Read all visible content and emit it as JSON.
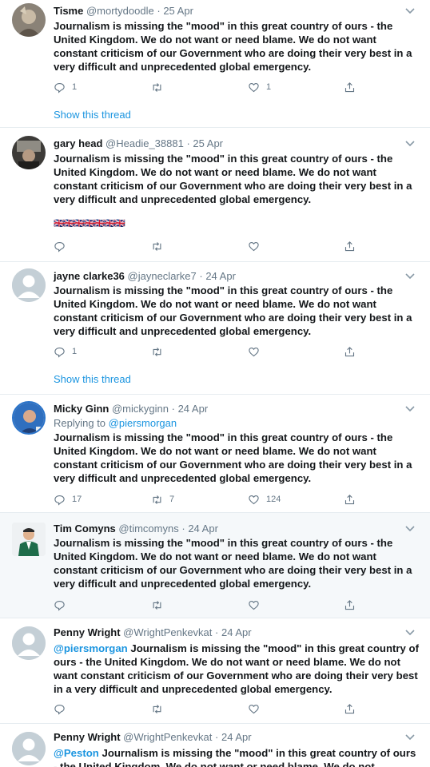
{
  "tweets": [
    {
      "name": "Tisme",
      "handle": "@mortydoodle",
      "date": "25 Apr",
      "text": "Journalism is missing the \"mood\" in this great country of ours - the United Kingdom. We do not want or need blame. We do not want constant criticism of our Government who are doing their very best in a very difficult and unprecedented global emergency.",
      "reply_count": "1",
      "retweet_count": "",
      "like_count": "1",
      "show_thread": "Show this thread"
    },
    {
      "name": "gary head",
      "handle": "@Headie_38881",
      "date": "25 Apr",
      "text": "Journalism is missing the \"mood\" in this great country of ours - the United Kingdom. We do not want or need blame. We do not want constant criticism of our Government who are doing their very best in a very difficult and unprecedented global emergency.",
      "flags": "🇬🇧🇬🇧🇬🇧🇬🇧🇬🇧🇬🇧🇬🇧",
      "reply_count": "",
      "retweet_count": "",
      "like_count": ""
    },
    {
      "name": "jayne clarke36",
      "handle": "@jayneclarke7",
      "date": "24 Apr",
      "text": "Journalism is missing the \"mood\" in this great country of ours - the United Kingdom. We do not want or need blame. We do not want constant criticism of our Government who are doing their very best in a very difficult and unprecedented global emergency.",
      "reply_count": "1",
      "retweet_count": "",
      "like_count": "",
      "show_thread": "Show this thread"
    },
    {
      "name": "Micky Ginn",
      "handle": "@mickyginn",
      "date": "24 Apr",
      "replying_prefix": "Replying to",
      "replying_handle": "@piersmorgan",
      "text": "Journalism is missing the \"mood\" in this great country of ours - the United Kingdom. We do not want or need blame. We do not want constant criticism of our Government who are doing their very best in a very difficult and unprecedented global emergency.",
      "reply_count": "17",
      "retweet_count": "7",
      "like_count": "124"
    },
    {
      "name": "Tim Comyns",
      "handle": "@timcomyns",
      "date": "24 Apr",
      "text": "Journalism is missing the \"mood\" in this great country of ours - the United Kingdom. We do not want or need blame. We do not want constant criticism of our Government who are doing their very best in a very difficult and unprecedented global emergency.",
      "reply_count": "",
      "retweet_count": "",
      "like_count": ""
    },
    {
      "name": "Penny Wright",
      "handle": "@WrightPenkevkat",
      "date": "24 Apr",
      "mention": "@piersmorgan",
      "text": " Journalism is missing the \"mood\" in this great country of ours - the United Kingdom. We do not want or need blame. We do not want constant criticism of our Government who are doing their very best in a very difficult and unprecedented global emergency.",
      "reply_count": "",
      "retweet_count": "",
      "like_count": ""
    },
    {
      "name": "Penny Wright",
      "handle": "@WrightPenkevkat",
      "date": "24 Apr",
      "mention": "@Peston",
      "text": " Journalism is missing the \"mood\" in this great country of ours - the United Kingdom. We do not want or need blame. We do not"
    }
  ],
  "separator": "·",
  "colors": {
    "link": "#1b95e0",
    "muted": "#657786",
    "text": "#14171a",
    "border": "#e6ecf0",
    "shaded_bg": "#f5f8fa"
  },
  "icons": {
    "reply": "reply-icon",
    "retweet": "retweet-icon",
    "like": "heart-icon",
    "share": "share-icon",
    "menu": "chevron-down-icon"
  }
}
